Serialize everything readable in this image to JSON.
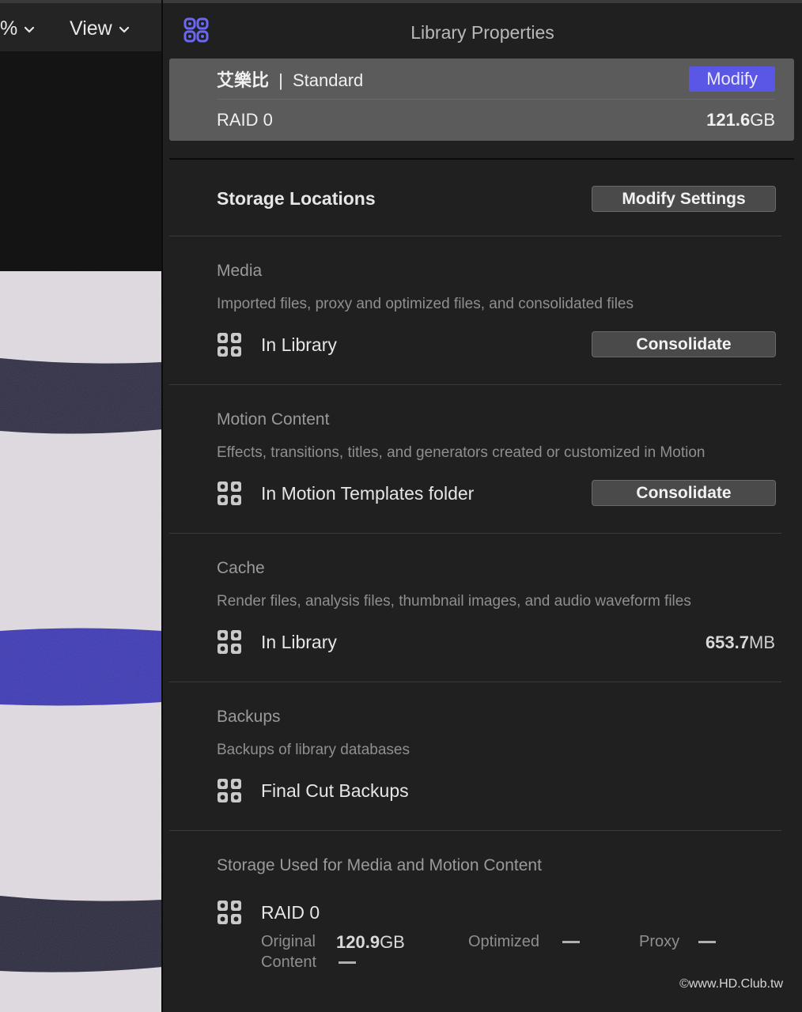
{
  "toolbar": {
    "zoom_label": "%",
    "view_label": "View"
  },
  "inspector": {
    "title": "Library Properties",
    "library": {
      "name": "艾樂比",
      "separator": "|",
      "type": "Standard",
      "modify_label": "Modify",
      "volume": "RAID 0",
      "size_value": "121.6",
      "size_unit": "GB"
    },
    "storage": {
      "header": "Storage Locations",
      "modify_settings_label": "Modify Settings"
    },
    "media": {
      "title": "Media",
      "description": "Imported files, proxy and optimized files, and consolidated files",
      "location": "In Library",
      "button_label": "Consolidate"
    },
    "motion": {
      "title": "Motion Content",
      "description": "Effects, transitions, titles, and generators created or customized in Motion",
      "location": "In Motion Templates folder",
      "button_label": "Consolidate"
    },
    "cache": {
      "title": "Cache",
      "description": "Render files, analysis files, thumbnail images, and audio waveform files",
      "location": "In Library",
      "size_value": "653.7",
      "size_unit": "MB"
    },
    "backups": {
      "title": "Backups",
      "description": "Backups of library databases",
      "location": "Final Cut Backups"
    },
    "usage": {
      "title": "Storage Used for Media and Motion Content",
      "volume": "RAID 0",
      "original_label_1": "Original",
      "original_label_2": "Content",
      "original_value": "120.9",
      "original_unit": "GB",
      "optimized_label": "Optimized",
      "proxy_label": "Proxy"
    }
  },
  "watermark": "©www.HD.Club.tw",
  "colors": {
    "accent": "#5b57e6",
    "panel": "#202020",
    "stripe_dark": "#2d2c44",
    "stripe_blue": "#3e3ab8"
  }
}
